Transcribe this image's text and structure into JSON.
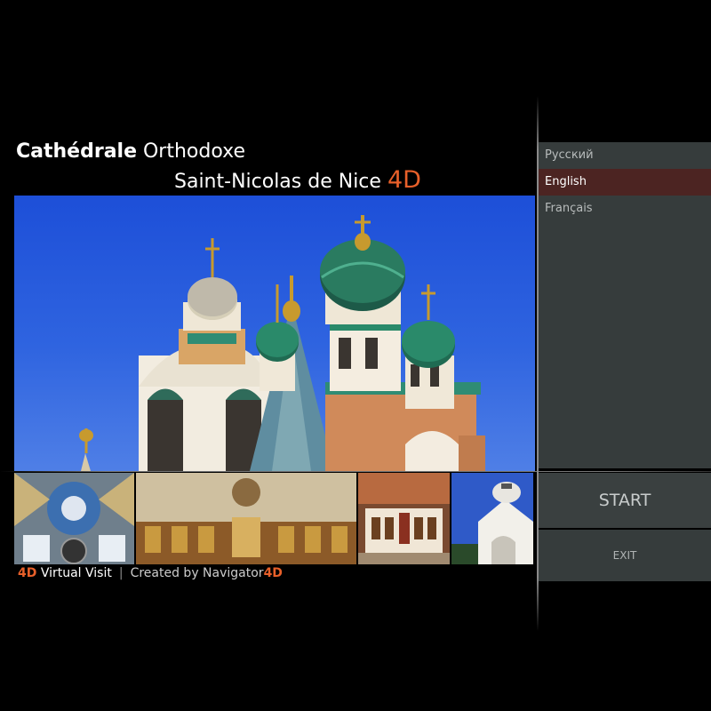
{
  "title": {
    "line1_bold": "Cathédrale",
    "line1_rest": " Orthodoxe",
    "line2": "Saint-Nicolas de Nice ",
    "line2_accent": "4D"
  },
  "languages": [
    {
      "label": "Русский",
      "active": false
    },
    {
      "label": "English",
      "active": true
    },
    {
      "label": "Français",
      "active": false
    }
  ],
  "buttons": {
    "start": "START",
    "exit": "EXIT"
  },
  "footer": {
    "brand_accent": "4D",
    "brand_rest": " Virtual Visit",
    "separator": "|",
    "credit_prefix": "Created by Navigator",
    "credit_accent": "4D"
  },
  "colors": {
    "accent": "#e8602a",
    "panel": "#363c3c",
    "active_language": "#4c2422"
  },
  "images": {
    "hero": "cathedral-exterior-photo",
    "thumbnails": [
      "dome-ceiling-photo",
      "iconostasis-photo",
      "altar-photo",
      "white-chapel-photo"
    ]
  }
}
